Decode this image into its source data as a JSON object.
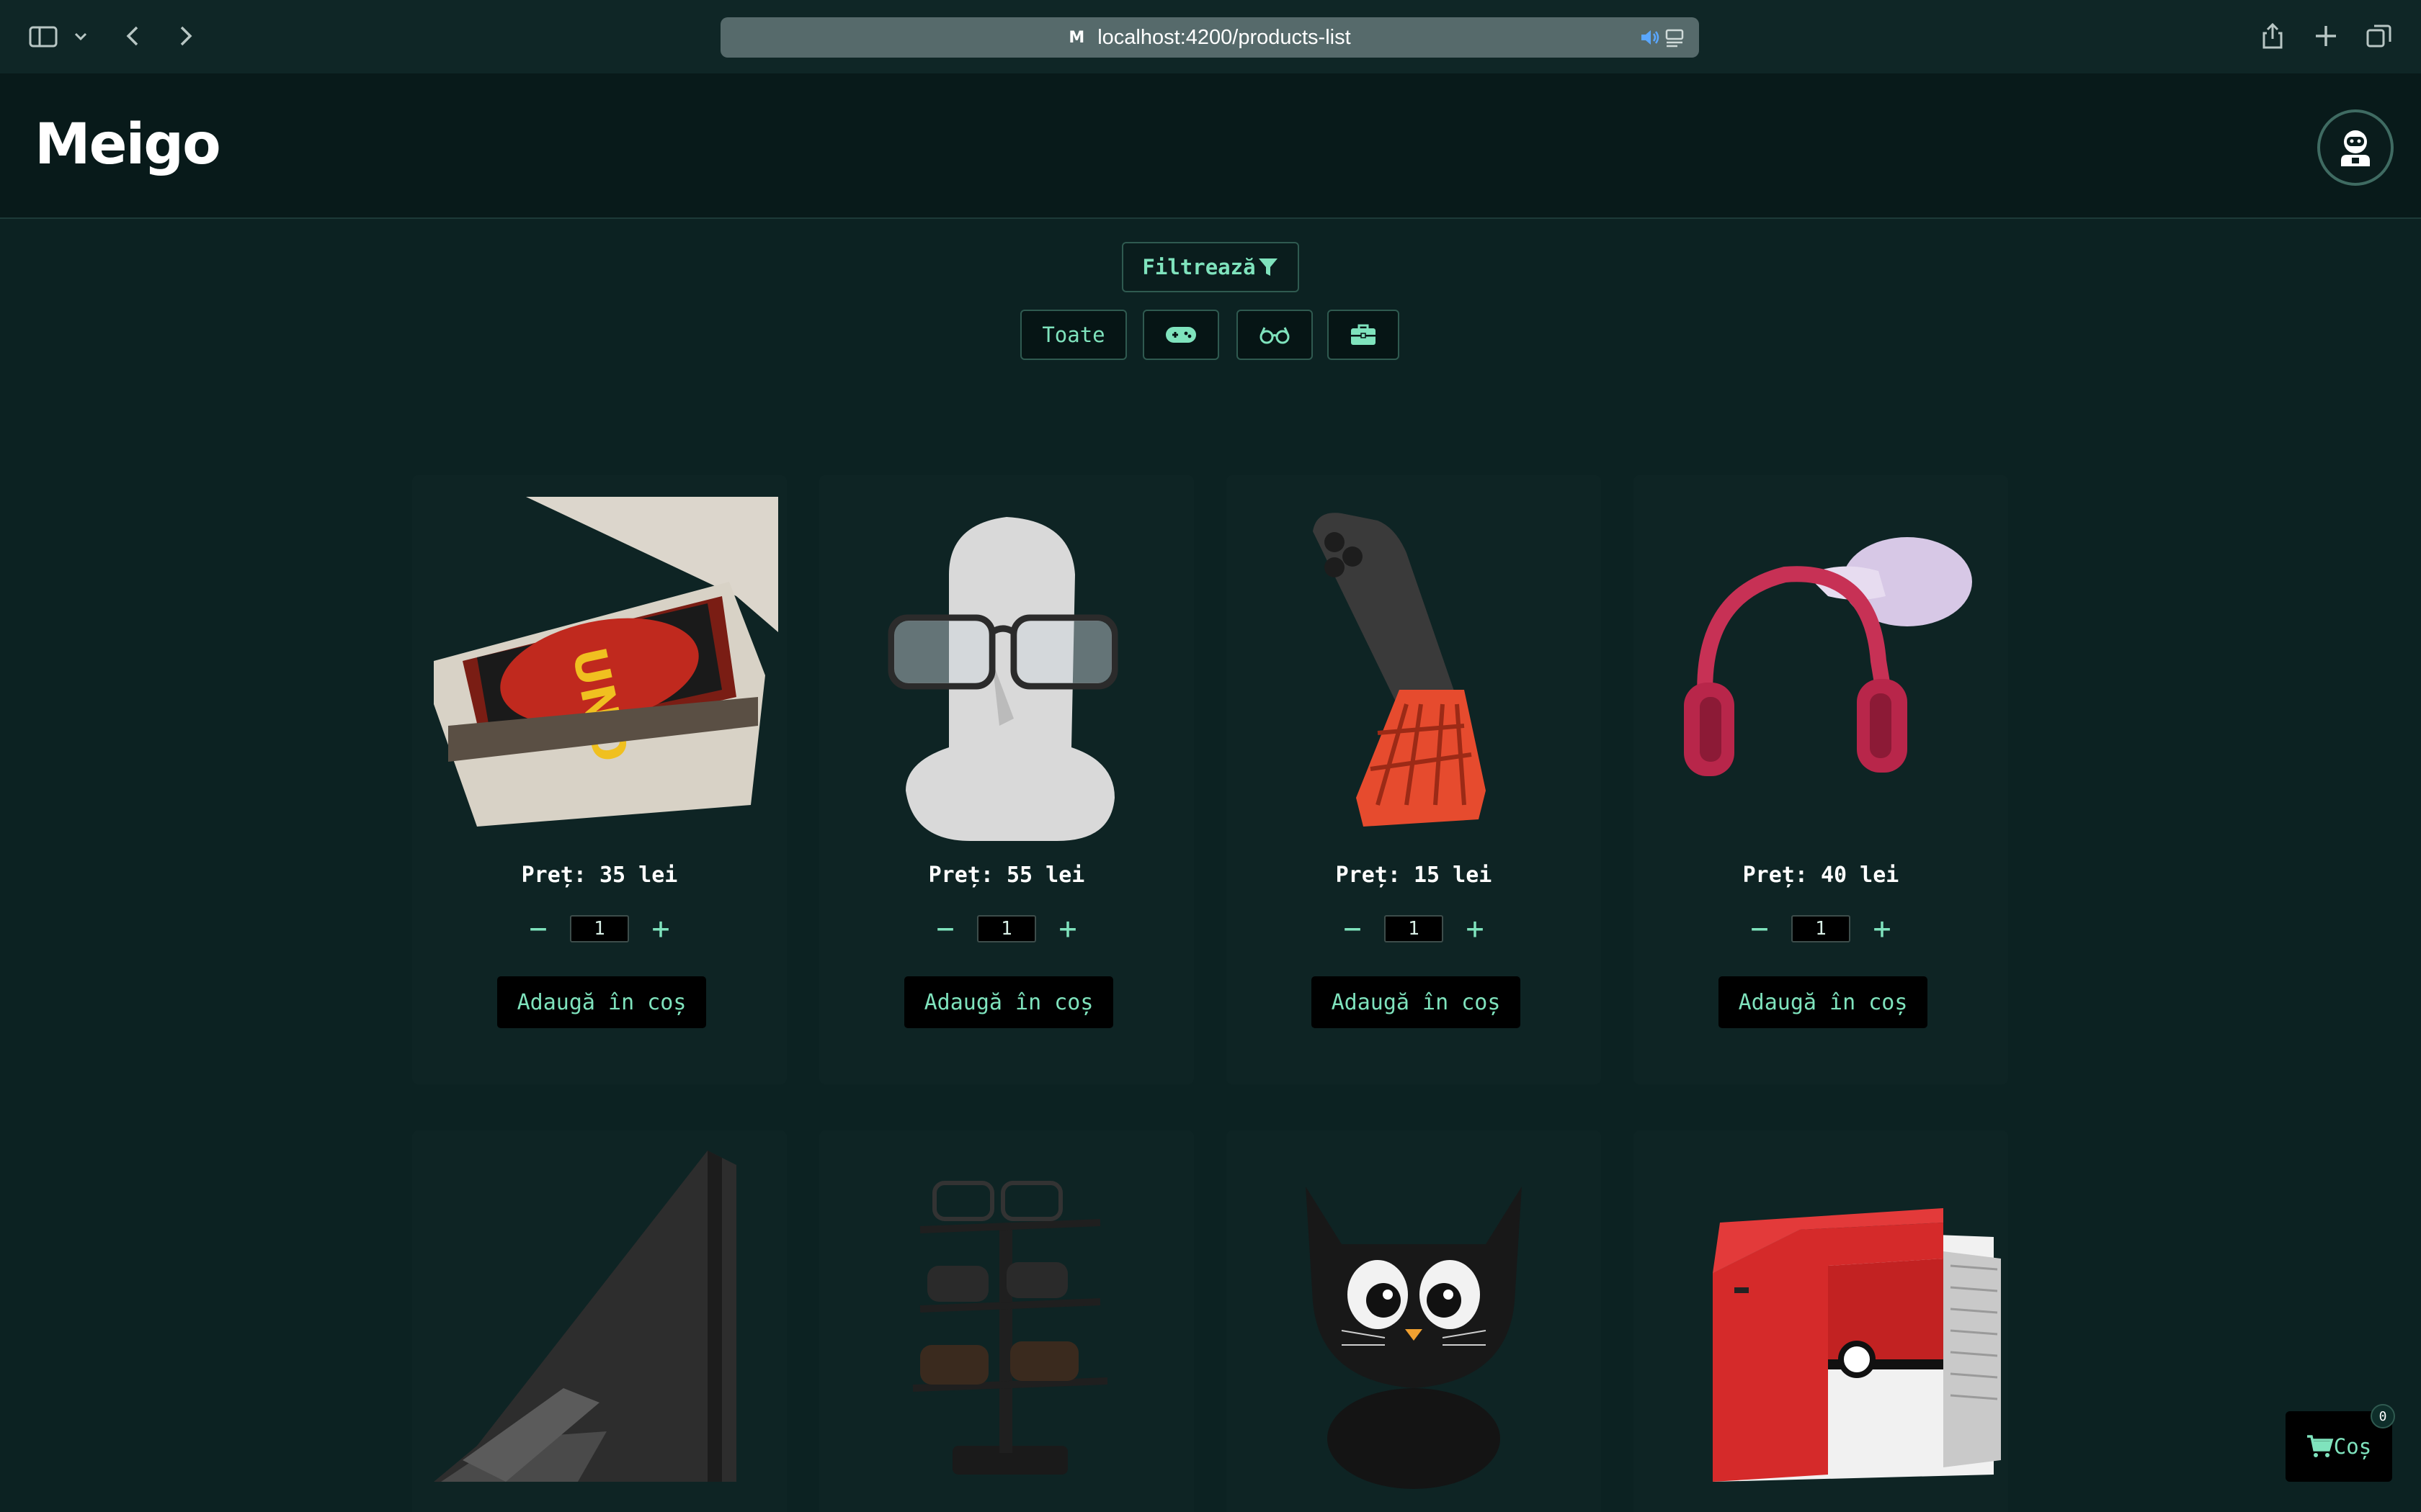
{
  "browser": {
    "url": "localhost:4200/products-list",
    "favicon": "M"
  },
  "header": {
    "logo": "Meigo",
    "account_icon": "robot-avatar-icon"
  },
  "filter": {
    "label": "Filtrează",
    "icon": "funnel-icon",
    "categories": [
      {
        "label": "Toate"
      },
      {
        "icon": "gamepad-icon"
      },
      {
        "icon": "glasses-icon"
      },
      {
        "icon": "briefcase-icon"
      }
    ]
  },
  "products": [
    {
      "image": "uno-card-box",
      "price": "Preț: 35 lei",
      "quantity": "1",
      "add_label": "Adaugă în coș"
    },
    {
      "image": "moai-glasses-holder",
      "price": "Preț: 55 lei",
      "quantity": "1",
      "add_label": "Adaugă în coș"
    },
    {
      "image": "phone-stand",
      "price": "Preț: 15 lei",
      "quantity": "1",
      "add_label": "Adaugă în coș"
    },
    {
      "image": "headphone-hand-hanger",
      "price": "Preț: 40 lei",
      "quantity": "1",
      "add_label": "Adaugă în coș"
    },
    {
      "image": "laptop-stand"
    },
    {
      "image": "glasses-rack"
    },
    {
      "image": "black-cat-figure"
    },
    {
      "image": "pokeball-card-box"
    }
  ],
  "cart": {
    "label": "Coș",
    "count": "0",
    "icon": "cart-icon"
  },
  "colors": {
    "background": "#0c2222",
    "accent": "#7fe3bd",
    "header": "#081a1a"
  }
}
